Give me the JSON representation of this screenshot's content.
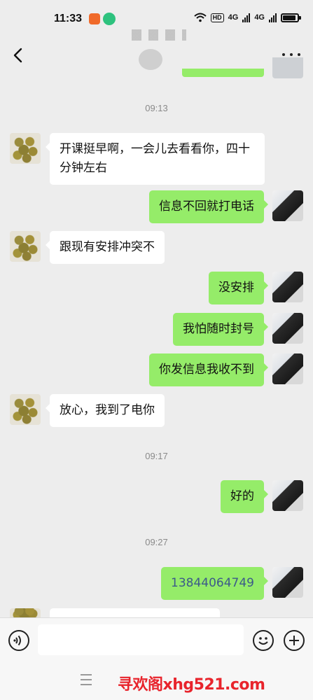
{
  "status_bar": {
    "time": "11:33",
    "hd": "HD",
    "network_1": "4G",
    "network_2": "4G"
  },
  "chat": {
    "messages": [
      {
        "type": "timestamp",
        "text": "09:13"
      },
      {
        "type": "incoming",
        "text": "开课挺早啊，一会儿去看看你，四十分钟左右"
      },
      {
        "type": "outgoing",
        "text": "信息不回就打电话"
      },
      {
        "type": "incoming",
        "text": "跟现有安排冲突不"
      },
      {
        "type": "outgoing",
        "text": "没安排"
      },
      {
        "type": "outgoing",
        "text": "我怕随时封号"
      },
      {
        "type": "outgoing",
        "text": "你发信息我收不到"
      },
      {
        "type": "incoming",
        "text": "放心，我到了电你"
      },
      {
        "type": "timestamp",
        "text": "09:17"
      },
      {
        "type": "outgoing",
        "text": "好的"
      },
      {
        "type": "timestamp",
        "text": "09:27"
      },
      {
        "type": "outgoing",
        "text": "13844064749"
      }
    ]
  },
  "watermark": "寻欢阁xhg521.com",
  "icons": {
    "back": "back-arrow-icon",
    "more": "more-dots-icon",
    "voice": "voice-icon",
    "emoji": "emoji-icon",
    "plus": "plus-icon",
    "menu": "menu-icon"
  },
  "colors": {
    "background": "#ededed",
    "outgoing_bubble": "#95ec69",
    "incoming_bubble": "#ffffff",
    "timestamp": "#8a8a8a",
    "phone_link": "#3c5a8a",
    "watermark": "#e8242c"
  }
}
